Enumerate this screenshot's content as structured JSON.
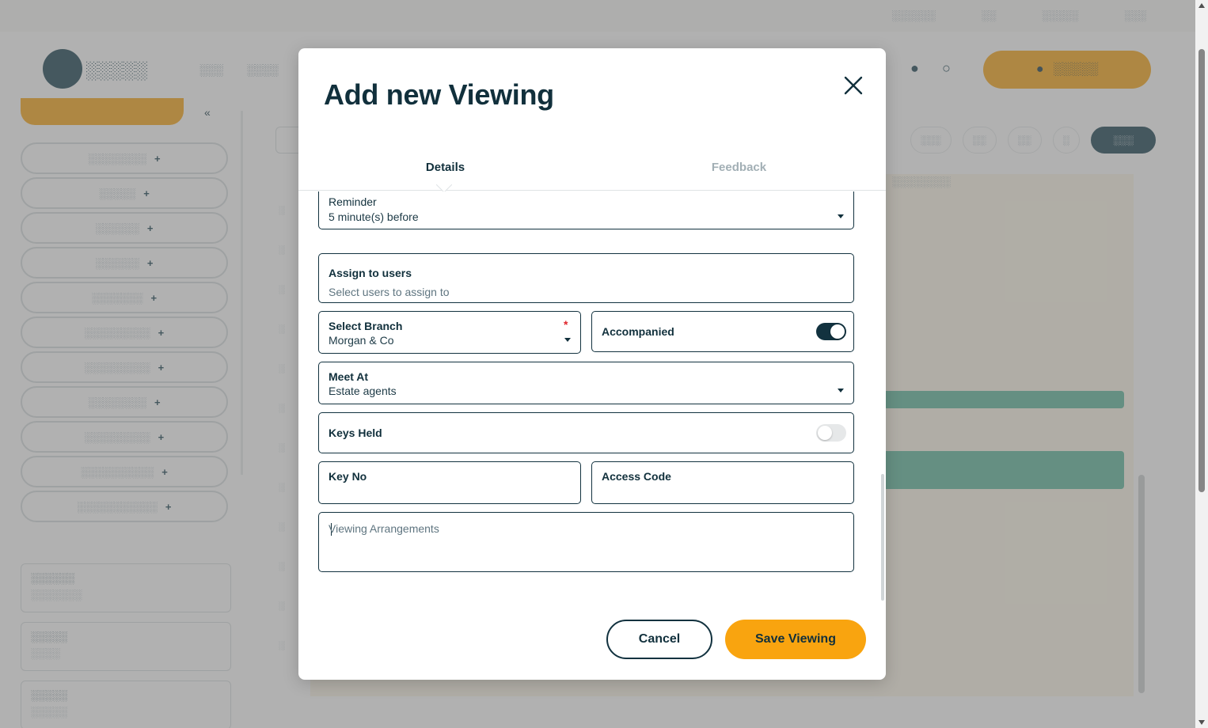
{
  "modal": {
    "title": "Add new Viewing",
    "tabs": [
      {
        "label": "Details",
        "active": true
      },
      {
        "label": "Feedback",
        "active": false
      }
    ],
    "fields": {
      "reminder": {
        "label": "Reminder",
        "value": "5 minute(s) before"
      },
      "assign_users": {
        "label": "Assign to users",
        "placeholder": "Select users to assign to"
      },
      "branch": {
        "label": "Select Branch",
        "value": "Morgan & Co",
        "required_mark": "*"
      },
      "accompanied": {
        "label": "Accompanied",
        "on": true
      },
      "meet_at": {
        "label": "Meet At",
        "value": "Estate agents"
      },
      "keys_held": {
        "label": "Keys Held",
        "on": false
      },
      "key_no": {
        "label": "Key No",
        "value": ""
      },
      "access_code": {
        "label": "Access Code",
        "value": ""
      },
      "viewing_arrangements": {
        "placeholder": "Viewing Arrangements"
      }
    },
    "buttons": {
      "cancel": "Cancel",
      "save": "Save Viewing"
    }
  },
  "colors": {
    "primary_dark": "#12323f",
    "accent_orange": "#f9a40f",
    "required_red": "#e0262c",
    "overlay": "rgba(110,110,110,0.52)"
  },
  "icons": {
    "close": "close-icon",
    "dropdown": "chevron-down-icon"
  }
}
